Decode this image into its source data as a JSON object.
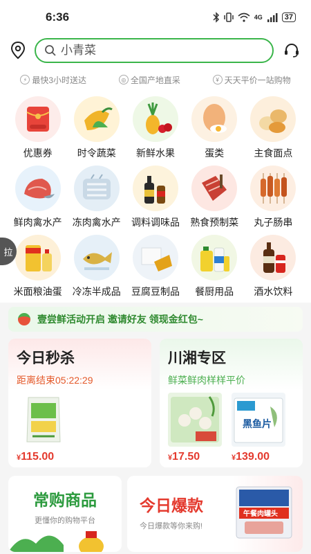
{
  "status_bar": {
    "time": "6:36",
    "battery": "37",
    "network": "4G"
  },
  "search": {
    "placeholder": "小青菜"
  },
  "features": [
    {
      "label": "最快3小时送达",
      "icon": "lightning-icon"
    },
    {
      "label": "全国产地直采",
      "icon": "globe-icon"
    },
    {
      "label": "天天平价一站购物",
      "icon": "yen-icon"
    }
  ],
  "side_tab": {
    "label": "拉"
  },
  "categories": [
    {
      "label": "优惠券",
      "icon": "coupon-icon"
    },
    {
      "label": "时令蔬菜",
      "icon": "vegetable-icon"
    },
    {
      "label": "新鲜水果",
      "icon": "fruit-icon"
    },
    {
      "label": "蛋类",
      "icon": "egg-icon"
    },
    {
      "label": "主食面点",
      "icon": "bun-icon"
    },
    {
      "label": "鲜肉禽水产",
      "icon": "meat-icon"
    },
    {
      "label": "冻肉禽水产",
      "icon": "frozen-meat-icon"
    },
    {
      "label": "调料调味品",
      "icon": "sauce-icon"
    },
    {
      "label": "熟食预制菜",
      "icon": "cooked-food-icon"
    },
    {
      "label": "丸子肠串",
      "icon": "skewer-icon"
    },
    {
      "label": "米面粮油蛋",
      "icon": "oil-icon"
    },
    {
      "label": "冷冻半成品",
      "icon": "frozen-fish-icon"
    },
    {
      "label": "豆腐豆制品",
      "icon": "tofu-icon"
    },
    {
      "label": "餐厨用品",
      "icon": "detergent-icon"
    },
    {
      "label": "酒水饮料",
      "icon": "beer-icon"
    }
  ],
  "banner": {
    "text": "壹尝鲜活动开启 邀请好友 领现金红包~"
  },
  "flash_sale": {
    "title": "今日秒杀",
    "countdown": "距离结束05:22:29",
    "products": [
      {
        "currency": "¥",
        "price": "115.00"
      }
    ]
  },
  "region": {
    "title": "川湘专区",
    "subtitle": "鲜菜鲜肉样样平价",
    "products": [
      {
        "currency": "¥",
        "price": "17.50"
      },
      {
        "currency": "¥",
        "price": "139.00",
        "package_text": "黑鱼片"
      }
    ]
  },
  "frequent": {
    "title": "常购商品",
    "subtitle": "更懂你的购物平台"
  },
  "hot": {
    "title": "今日爆款",
    "subtitle": "今日爆款等你来购!",
    "package_text": "午餐肉罐头"
  },
  "colors": {
    "brand_green": "#3ab54a",
    "price_red": "#e43a2e",
    "countdown_orange": "#e45a2b"
  }
}
